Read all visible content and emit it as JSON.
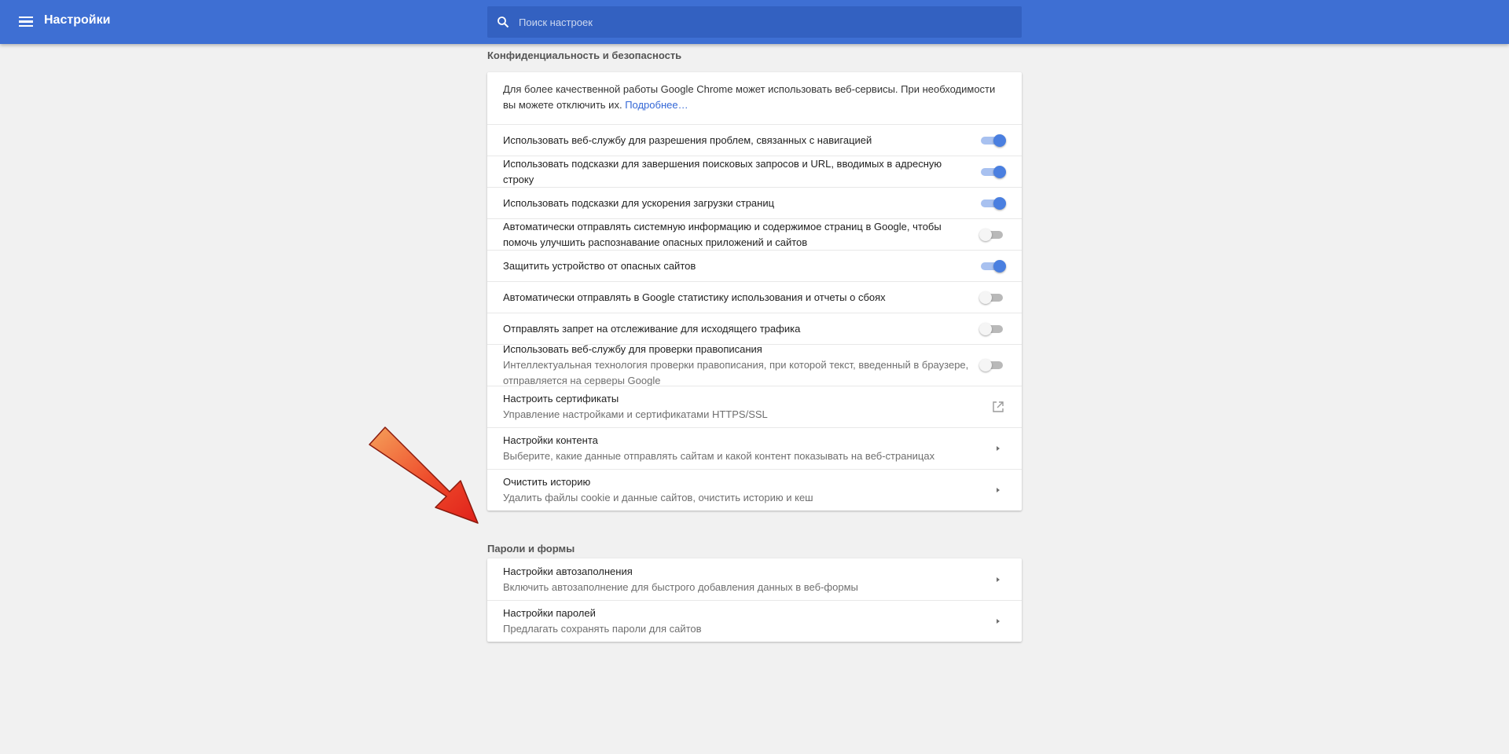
{
  "header": {
    "title": "Настройки",
    "search_placeholder": "Поиск настроек"
  },
  "privacy": {
    "section_title": "Конфиденциальность и безопасность",
    "intro_text": "Для более качественной работы Google Chrome может использовать веб-сервисы. При необходимости вы можете отключить их.",
    "intro_link": "Подробнее…",
    "rows": [
      {
        "title": "Использовать веб-службу для разрешения проблем, связанных с навигацией",
        "toggle": "on"
      },
      {
        "title": "Использовать подсказки для завершения поисковых запросов и URL, вводимых в адресную строку",
        "toggle": "on"
      },
      {
        "title": "Использовать подсказки для ускорения загрузки страниц",
        "toggle": "on"
      },
      {
        "title": "Автоматически отправлять системную информацию и содержимое страниц в Google, чтобы помочь улучшить распознавание опасных приложений и сайтов",
        "toggle": "off"
      },
      {
        "title": "Защитить устройство от опасных сайтов",
        "toggle": "on"
      },
      {
        "title": "Автоматически отправлять в Google статистику использования и отчеты о сбоях",
        "toggle": "off"
      },
      {
        "title": "Отправлять запрет на отслеживание для исходящего трафика",
        "toggle": "off"
      },
      {
        "title": "Использовать веб-службу для проверки правописания",
        "subtitle": "Интеллектуальная технология проверки правописания, при которой текст, введенный в браузере, отправляется на серверы Google",
        "toggle": "off"
      },
      {
        "title": "Настроить сертификаты",
        "subtitle": "Управление настройками и сертификатами HTTPS/SSL",
        "icon": "external-link-icon"
      },
      {
        "title": "Настройки контента",
        "subtitle": "Выберите, какие данные отправлять сайтам и какой контент показывать на веб-страницах",
        "icon": "chevron-right-icon"
      },
      {
        "title": "Очистить историю",
        "subtitle": "Удалить файлы cookie и данные сайтов, очистить историю и кеш",
        "icon": "chevron-right-icon"
      }
    ]
  },
  "passwords": {
    "section_title": "Пароли и формы",
    "rows": [
      {
        "title": "Настройки автозаполнения",
        "subtitle": "Включить автозаполнение для быстрого добавления данных в веб-формы",
        "icon": "chevron-right-icon"
      },
      {
        "title": "Настройки паролей",
        "subtitle": "Предлагать сохранять пароли для сайтов",
        "icon": "chevron-right-icon"
      }
    ]
  },
  "colors": {
    "header_bg": "#3e6fd3",
    "accent": "#4a7fe0",
    "annotation_arrow": "#e8301e"
  }
}
